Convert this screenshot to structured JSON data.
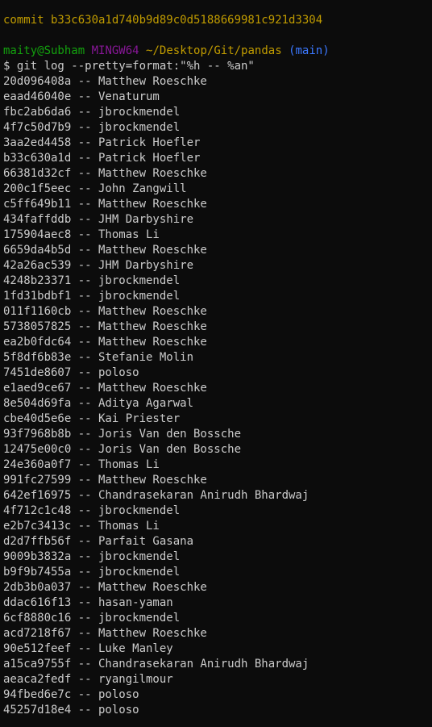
{
  "terminal": {
    "header_commit": "commit b33c630a1d740b9d89c0d5188669981c921d3304",
    "prompt": {
      "user_host": "maity@Subham",
      "shell": "MINGW64",
      "path": "~/Desktop/Git/pandas",
      "branch": "(main)"
    },
    "command": "$ git log --pretty=format:\"%h -- %an\"",
    "log_lines": [
      "20d096408a -- Matthew Roeschke",
      "eaad46040e -- Venaturum",
      "fbc2ab6da6 -- jbrockmendel",
      "4f7c50d7b9 -- jbrockmendel",
      "3aa2ed4458 -- Patrick Hoefler",
      "b33c630a1d -- Patrick Hoefler",
      "66381d32cf -- Matthew Roeschke",
      "200c1f5eec -- John Zangwill",
      "c5ff649b11 -- Matthew Roeschke",
      "434faffddb -- JHM Darbyshire",
      "175904aec8 -- Thomas Li",
      "6659da4b5d -- Matthew Roeschke",
      "42a26ac539 -- JHM Darbyshire",
      "4248b23371 -- jbrockmendel",
      "1fd31bdbf1 -- jbrockmendel",
      "011f1160cb -- Matthew Roeschke",
      "5738057825 -- Matthew Roeschke",
      "ea2b0fdc64 -- Matthew Roeschke",
      "5f8df6b83e -- Stefanie Molin",
      "7451de8607 -- poloso",
      "e1aed9ce67 -- Matthew Roeschke",
      "8e504d69fa -- Aditya Agarwal",
      "cbe40d5e6e -- Kai Priester",
      "93f7968b8b -- Joris Van den Bossche",
      "12475e00c0 -- Joris Van den Bossche",
      "24e360a0f7 -- Thomas Li",
      "991fc27599 -- Matthew Roeschke",
      "642ef16975 -- Chandrasekaran Anirudh Bhardwaj",
      "4f712c1c48 -- jbrockmendel",
      "e2b7c3413c -- Thomas Li",
      "d2d7ffb56f -- Parfait Gasana",
      "9009b3832a -- jbrockmendel",
      "b9f9b7455a -- jbrockmendel",
      "2db3b0a037 -- Matthew Roeschke",
      "ddac616f13 -- hasan-yaman",
      "6cf8880c16 -- jbrockmendel",
      "acd7218f67 -- Matthew Roeschke",
      "90e512feef -- Luke Manley",
      "a15ca9755f -- Chandrasekaran Anirudh Bhardwaj",
      "aeaca2fedf -- ryangilmour",
      "94fbed6e7c -- poloso",
      "45257d18e4 -- poloso"
    ]
  },
  "colors": {
    "background": "#0c0c0c",
    "text": "#cccccc",
    "yellow": "#c19c00",
    "green": "#13a10e",
    "magenta": "#881798",
    "blue": "#3b78ff"
  }
}
